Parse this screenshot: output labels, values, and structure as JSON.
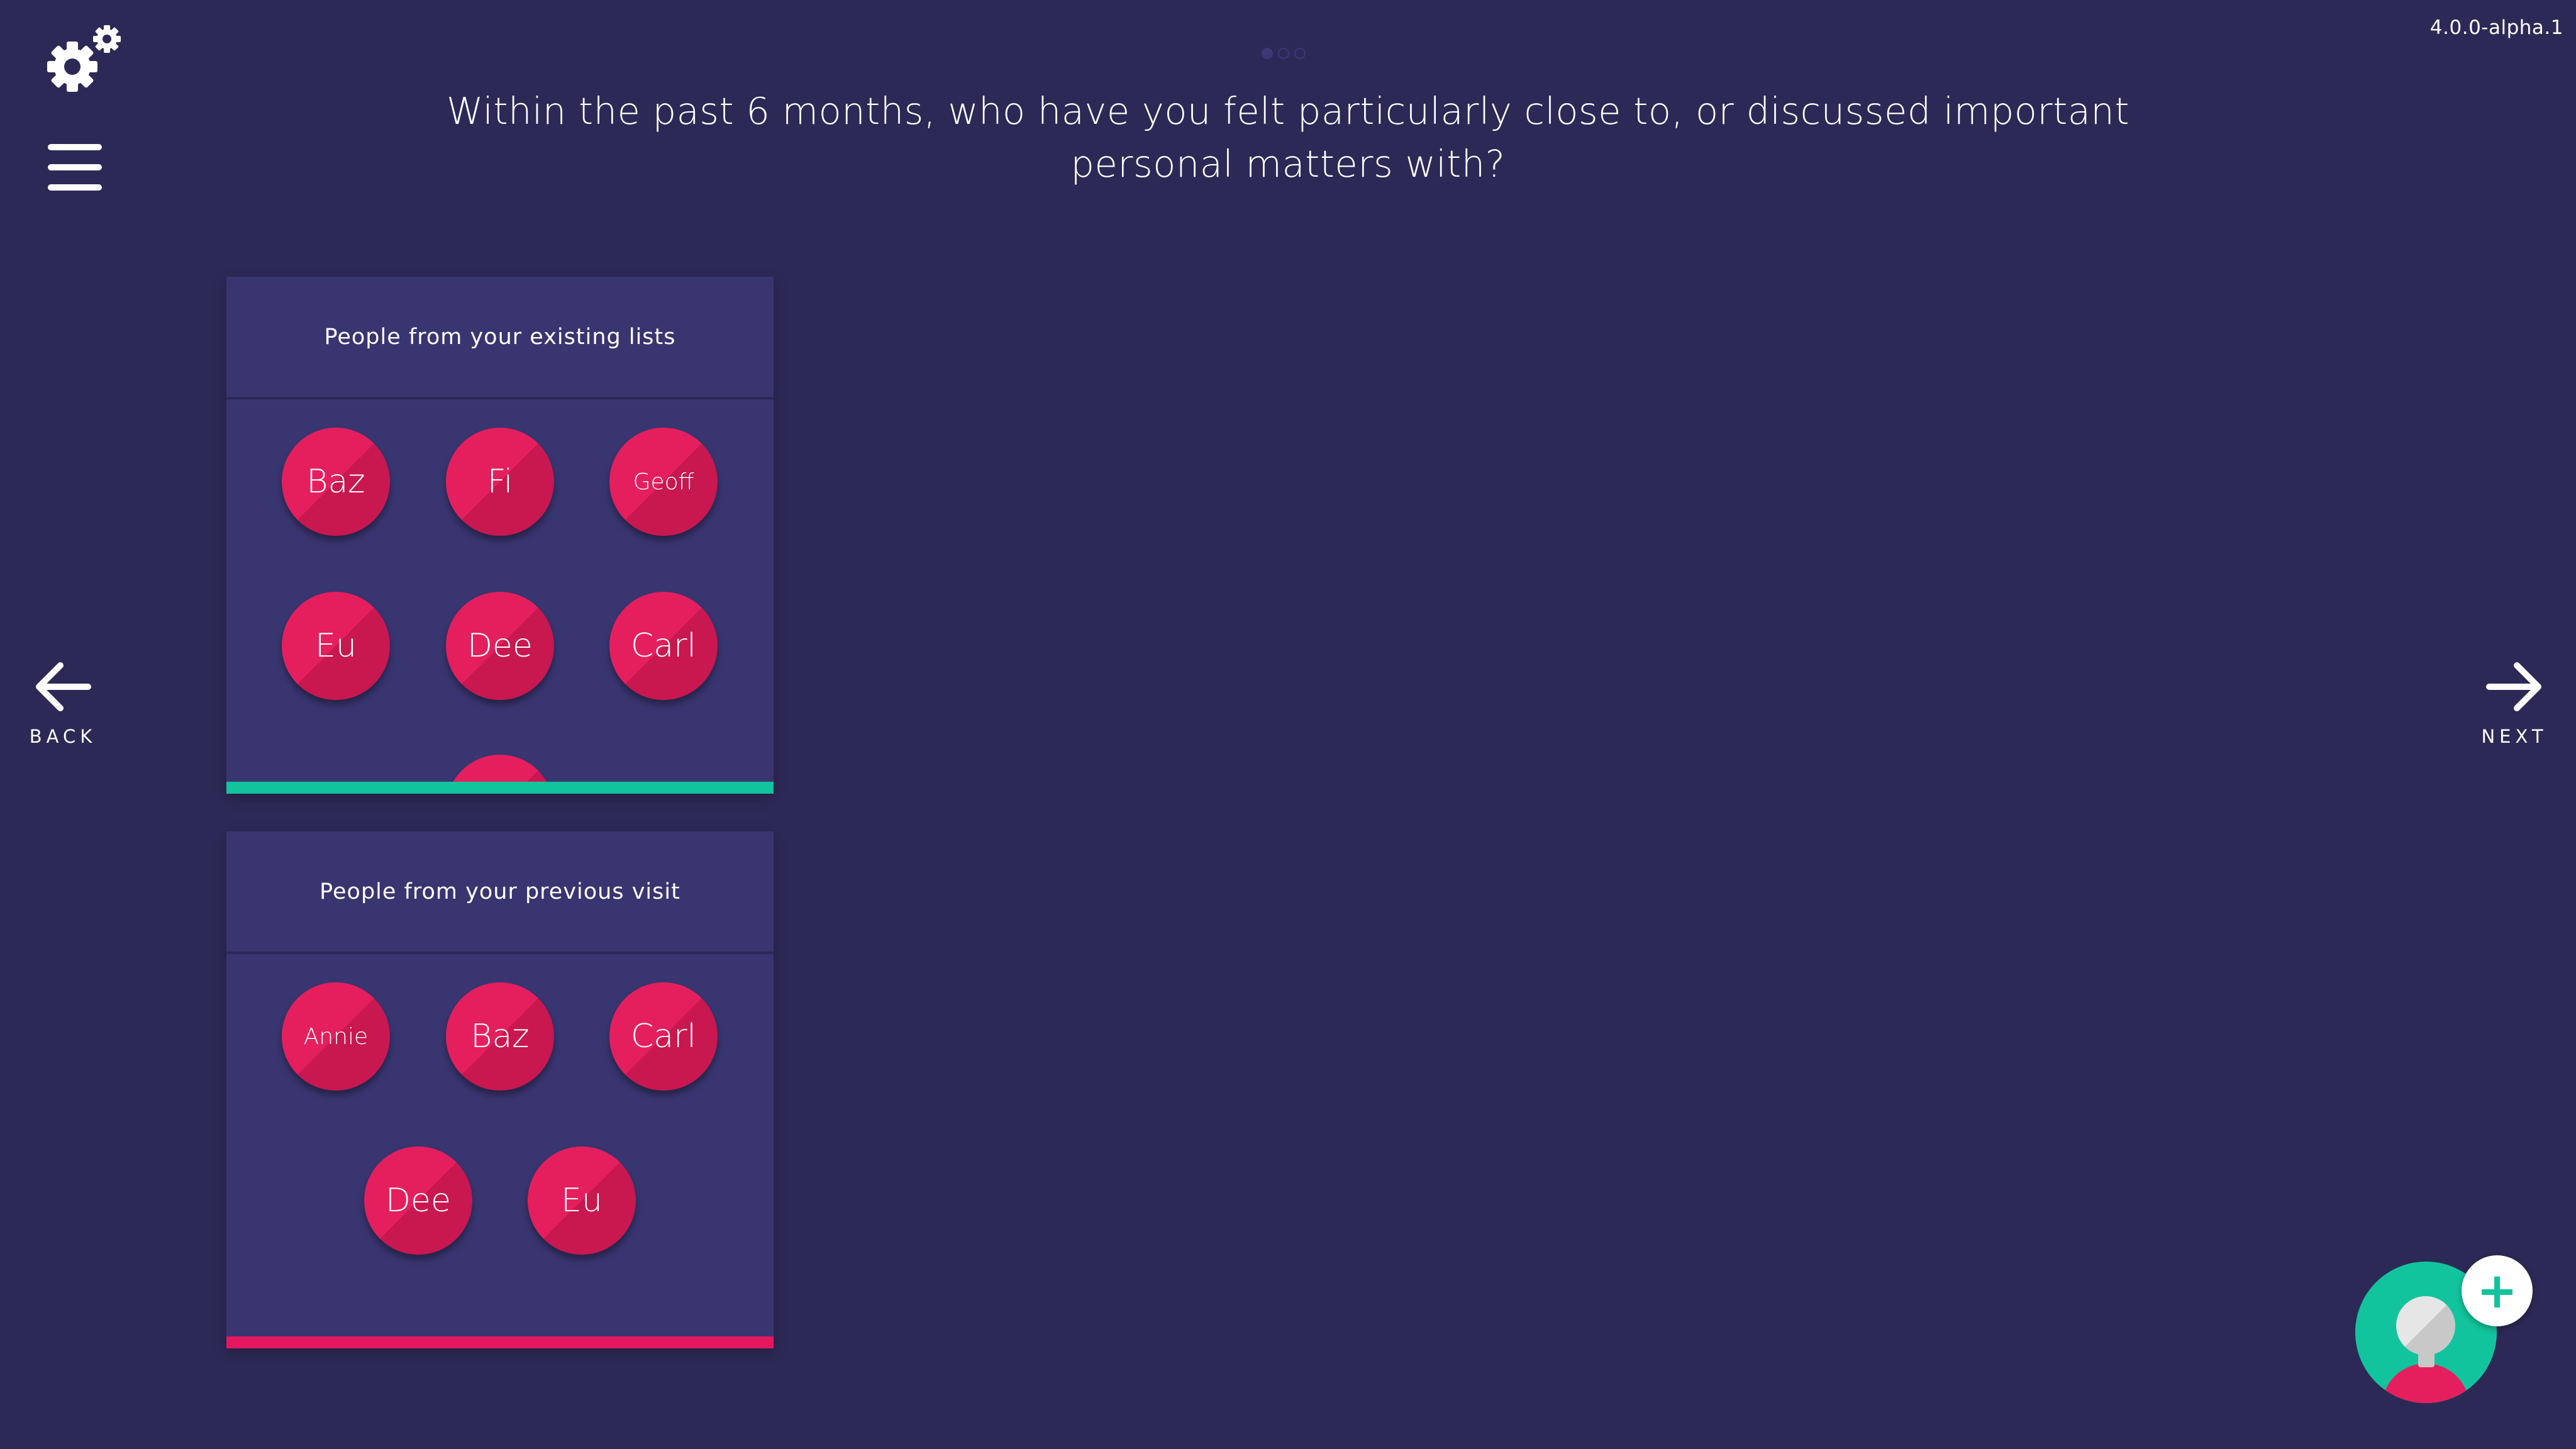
{
  "app": {
    "version": "4.0.0-alpha.1"
  },
  "toolbar": {
    "settings_icon": "gears-icon",
    "menu_icon": "hamburger-menu-icon"
  },
  "pager": {
    "count": 3,
    "active_index": 0
  },
  "prompt": {
    "text": "Within the past 6 months, who have you felt particularly close to, or discussed important personal matters with?"
  },
  "navigation": {
    "back_label": "BACK",
    "next_label": "NEXT"
  },
  "panels": [
    {
      "title": "People from your existing lists",
      "accent_color": "#12c49d",
      "nodes": [
        "Baz",
        "Fi",
        "Geoff",
        "Eu",
        "Dee",
        "Carl"
      ]
    },
    {
      "title": "People from your previous visit",
      "accent_color": "#e5185f",
      "nodes": [
        "Annie",
        "Baz",
        "Carl",
        "Dee",
        "Eu"
      ]
    }
  ],
  "add_person": {
    "icon": "add-person-icon",
    "plus_symbol": "+"
  },
  "colors": {
    "background": "#2d2956",
    "panel": "#393570",
    "node": "#e51f5e",
    "accent_teal": "#12c49d"
  }
}
